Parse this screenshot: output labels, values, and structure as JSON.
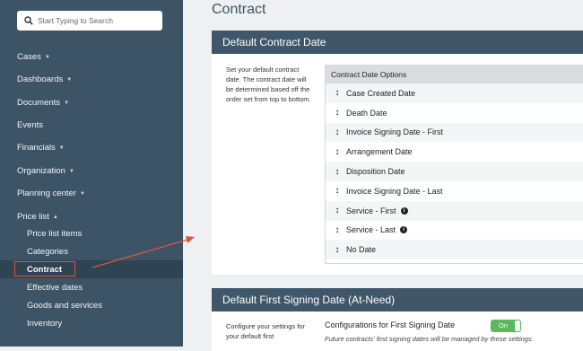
{
  "search": {
    "placeholder": "Start Typing to Search"
  },
  "sidebar": {
    "items": [
      {
        "label": "Cases",
        "caret": "▼"
      },
      {
        "label": "Dashboards",
        "caret": "▼"
      },
      {
        "label": "Documents",
        "caret": "▼"
      },
      {
        "label": "Events",
        "caret": ""
      },
      {
        "label": "Financials",
        "caret": "▼"
      },
      {
        "label": "Organization",
        "caret": "▼"
      },
      {
        "label": "Planning center",
        "caret": "▼"
      },
      {
        "label": "Price list",
        "caret": "▲"
      }
    ],
    "subitems": [
      "Price list items",
      "Categories",
      "Contract",
      "Effective dates",
      "Goods and services",
      "Inventory"
    ]
  },
  "page": {
    "title": "Contract"
  },
  "default_contract_date": {
    "header": "Default Contract Date",
    "description": "Set your default contract date.  The contract date will be determined based off the order set from top to bottom.",
    "table_header": "Contract Date Options",
    "options": [
      {
        "label": "Case Created Date",
        "info": false
      },
      {
        "label": "Death Date",
        "info": false
      },
      {
        "label": "Invoice Signing Date - First",
        "info": false
      },
      {
        "label": "Arrangement Date",
        "info": false
      },
      {
        "label": "Disposition Date",
        "info": false
      },
      {
        "label": "Invoice Signing Date - Last",
        "info": false
      },
      {
        "label": "Service - First",
        "info": true
      },
      {
        "label": "Service - Last",
        "info": true
      },
      {
        "label": "No Date",
        "info": false
      }
    ]
  },
  "default_first_signing": {
    "header": "Default First Signing Date (At-Need)",
    "description": "Configure your settings for your default first",
    "config_label": "Configurations for First Signing Date",
    "toggle_label": "On",
    "note": "Future contracts' first signing dates will be managed by these settings."
  },
  "colors": {
    "sidebar_bg": "#3d5466",
    "header_bg": "#3f5769",
    "highlight": "#e2523a",
    "toggle_on": "#5cb85c"
  },
  "icons": {
    "search": "search-icon",
    "drag": "drag-handle-icon",
    "info": "info-icon"
  }
}
